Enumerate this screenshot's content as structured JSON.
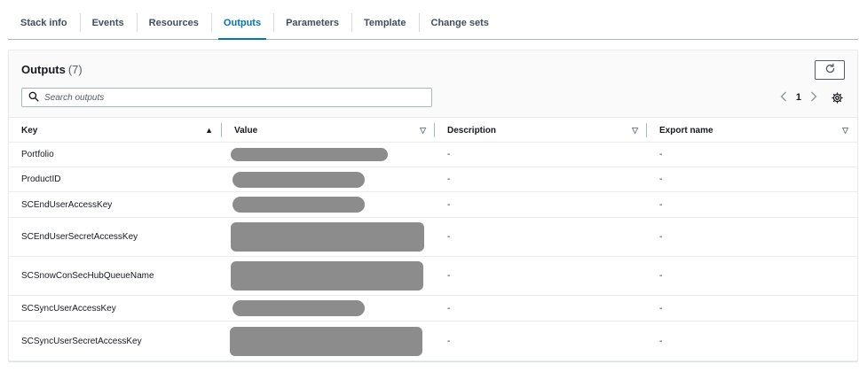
{
  "tabs": [
    {
      "label": "Stack info",
      "active": false
    },
    {
      "label": "Events",
      "active": false
    },
    {
      "label": "Resources",
      "active": false
    },
    {
      "label": "Outputs",
      "active": true
    },
    {
      "label": "Parameters",
      "active": false
    },
    {
      "label": "Template",
      "active": false
    },
    {
      "label": "Change sets",
      "active": false
    }
  ],
  "panel": {
    "title": "Outputs",
    "count": "(7)",
    "refresh_icon": "refresh-icon",
    "search": {
      "placeholder": "Search outputs",
      "value": ""
    },
    "pagination": {
      "current_page": "1"
    },
    "settings_icon": "gear-icon"
  },
  "table": {
    "columns": [
      {
        "label": "Key",
        "sort": "ascending"
      },
      {
        "label": "Value",
        "sort": "none"
      },
      {
        "label": "Description",
        "sort": "none"
      },
      {
        "label": "Export name",
        "sort": "none"
      }
    ],
    "rows": [
      {
        "key": "Portfolio",
        "value_redacted": true,
        "description": "-",
        "export_name": "-"
      },
      {
        "key": "ProductID",
        "value_redacted": true,
        "description": "-",
        "export_name": "-"
      },
      {
        "key": "SCEndUserAccessKey",
        "value_redacted": true,
        "description": "-",
        "export_name": "-"
      },
      {
        "key": "SCEndUserSecretAccessKey",
        "value_redacted": true,
        "description": "-",
        "export_name": "-"
      },
      {
        "key": "SCSnowConSecHubQueueName",
        "value_redacted": true,
        "description": "-",
        "export_name": "-"
      },
      {
        "key": "SCSyncUserAccessKey",
        "value_redacted": true,
        "description": "-",
        "export_name": "-"
      },
      {
        "key": "SCSyncUserSecretAccessKey",
        "value_redacted": true,
        "description": "-",
        "export_name": "-"
      }
    ]
  },
  "colors": {
    "accent": "#0073bb",
    "redaction": "#8c8c8c"
  }
}
